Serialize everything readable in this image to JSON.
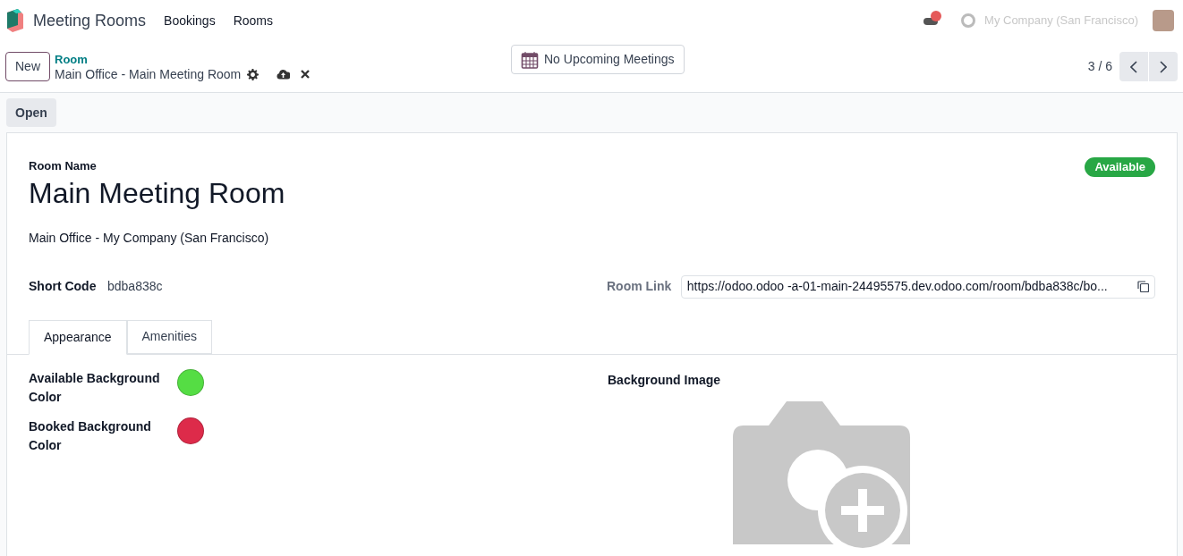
{
  "navbar": {
    "app_name": "Meeting Rooms",
    "menus": [
      "Bookings",
      "Rooms"
    ],
    "company": "My Company (San Francisco)"
  },
  "control_panel": {
    "new_button": "New",
    "breadcrumb_parent": "Room",
    "record_name": "Main Office - Main Meeting Room",
    "meetings_button": "No Upcoming Meetings",
    "pager": "3 / 6"
  },
  "action_bar": {
    "buttons": [
      "Open"
    ]
  },
  "form": {
    "name_label": "Room Name",
    "name": "Main Meeting Room",
    "status": "Available",
    "location": "Main Office - My Company (San Francisco)",
    "short_code_label": "Short Code",
    "short_code": "bdba838c",
    "room_link_label": "Room Link",
    "room_link": "https://odoo.odoo -a-01-main-24495575.dev.odoo.com/room/bdba838c/bo...",
    "tabs": [
      {
        "label": "Appearance",
        "selected": true
      },
      {
        "label": "Amenities",
        "selected": false
      }
    ],
    "colors": [
      {
        "label": "Available Background Color",
        "color": "#55dd44"
      },
      {
        "label": "Booked Background Color",
        "color": "#dd2b4a"
      }
    ],
    "background_image_label": "Background Image"
  }
}
